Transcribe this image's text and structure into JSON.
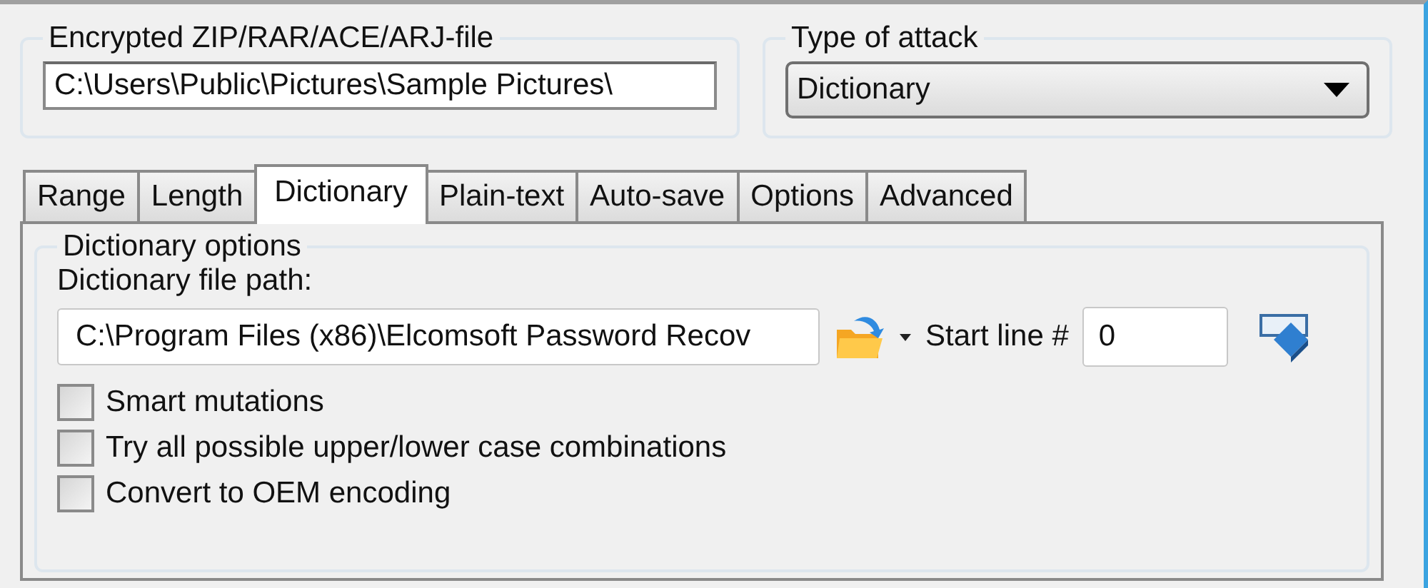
{
  "archive_group": {
    "title": "Encrypted ZIP/RAR/ACE/ARJ-file",
    "value": "C:\\Users\\Public\\Pictures\\Sample Pictures\\"
  },
  "attack_group": {
    "title": "Type of attack",
    "value": "Dictionary"
  },
  "tabs": [
    {
      "label": "Range",
      "selected": false
    },
    {
      "label": "Length",
      "selected": false
    },
    {
      "label": "Dictionary",
      "selected": true
    },
    {
      "label": "Plain-text",
      "selected": false
    },
    {
      "label": "Auto-save",
      "selected": false
    },
    {
      "label": "Options",
      "selected": false
    },
    {
      "label": "Advanced",
      "selected": false
    }
  ],
  "dictionary_options": {
    "title": "Dictionary options",
    "path_label": "Dictionary file path:",
    "path_value": "C:\\Program Files (x86)\\Elcomsoft Password Recov",
    "start_line_label": "Start line #",
    "start_line_value": "0",
    "checkboxes": [
      {
        "label": "Smart mutations",
        "checked": false
      },
      {
        "label": "Try all possible upper/lower case combinations",
        "checked": false
      },
      {
        "label": "Convert to OEM encoding",
        "checked": false
      }
    ]
  }
}
